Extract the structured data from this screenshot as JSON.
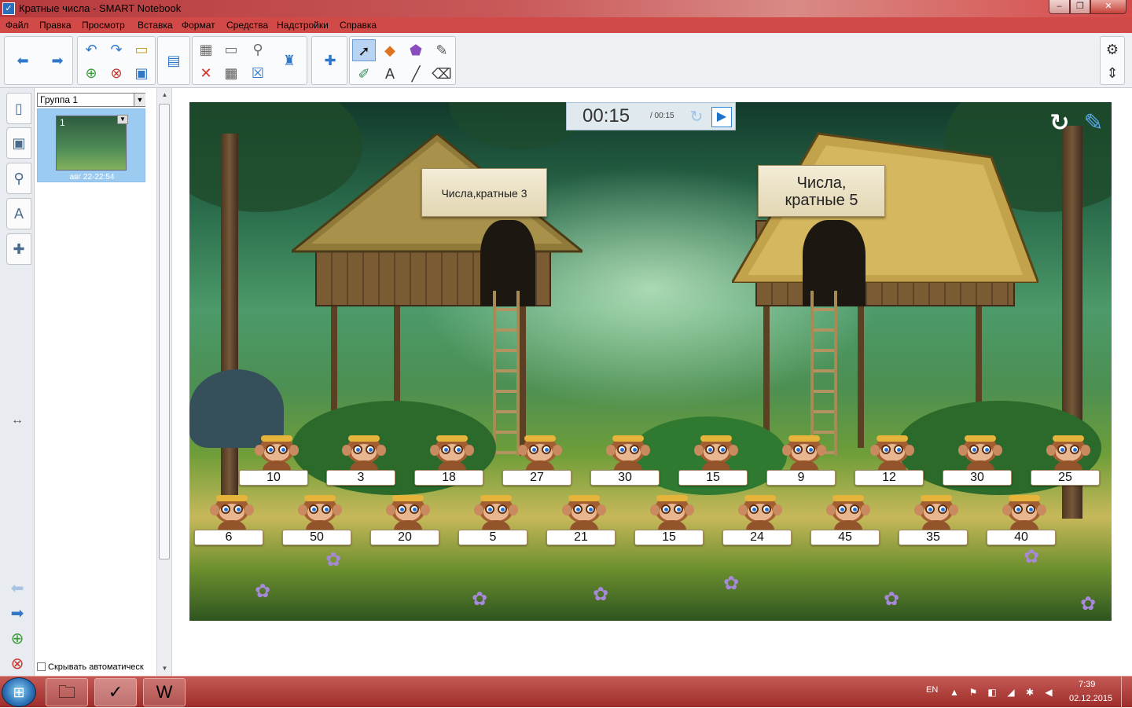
{
  "window": {
    "title": "Кратные числа - SMART Notebook",
    "minimize": "–",
    "maximize": "❐",
    "close": "✕"
  },
  "menu": [
    "Файл",
    "Правка",
    "Просмотр",
    "Вставка",
    "Формат",
    "Средства",
    "Надстройки",
    "Справка"
  ],
  "sidebar": {
    "group_select": "Группа 1",
    "page_number": "1",
    "page_caption": "авг 22-22:54",
    "autohide_label": "Скрывать автоматическ"
  },
  "activity": {
    "timer": {
      "elapsed": "00:15",
      "total": "/ 00:15"
    },
    "sign_left": "Числа,кратные 3",
    "sign_right_line1": "Числа,",
    "sign_right_line2": "кратные 5",
    "row1_numbers": [
      "10",
      "3",
      "18",
      "27",
      "30",
      "15",
      "9",
      "12",
      "30",
      "25"
    ],
    "row2_numbers": [
      "6",
      "50",
      "20",
      "5",
      "21",
      "15",
      "24",
      "45",
      "35",
      "40"
    ]
  },
  "taskbar": {
    "language": "EN",
    "time": "7:39",
    "date": "02.12.2015"
  },
  "colors": {
    "titlebar": "#c95859",
    "menubar": "#d24a47",
    "taskbar": "#9e2d2a",
    "timer_play": "#1c73c8"
  }
}
